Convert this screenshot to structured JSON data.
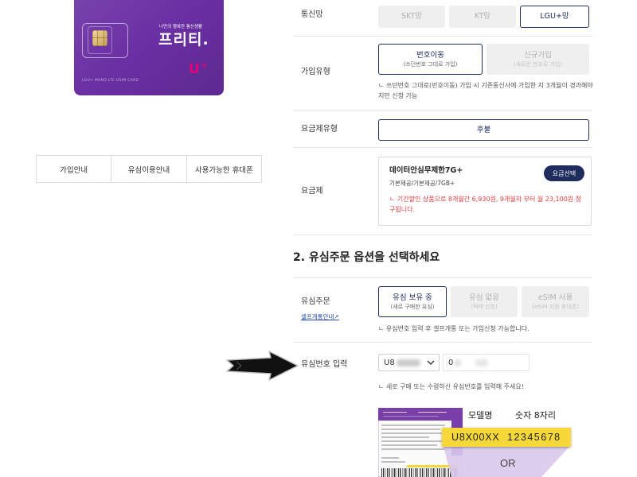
{
  "sim_card": {
    "tagline": "나만의 행복한 통신생활",
    "brand": "프리티.",
    "carrier_logo_letter": "U",
    "carrier_logo_plus": "+",
    "caption": "LGU+ MVNO LTE USIM CARD"
  },
  "info_tabs": [
    "가입안내",
    "유심이용안내",
    "사용가능한 휴대폰"
  ],
  "network": {
    "label": "통신망",
    "options": [
      {
        "label": "SKT망",
        "selected": false
      },
      {
        "label": "KT망",
        "selected": false
      },
      {
        "label": "LGU+망",
        "selected": true
      }
    ]
  },
  "join_type": {
    "label": "가입유형",
    "options": [
      {
        "title": "번호이동",
        "sub": "(쓰던번호 그대로 가입)",
        "selected": true
      },
      {
        "title": "신규가입",
        "sub": "(새로운 번호로 가입)",
        "selected": false
      }
    ],
    "note": "ㄴ 쓰던번호 그대로(번호이동) 가입 시 기존통신사에 가입한 지 3개월이 경과해야지만 신청 가능"
  },
  "plan_type": {
    "label": "요금제유형",
    "options": [
      {
        "label": "후불",
        "selected": true
      }
    ]
  },
  "plan": {
    "label": "요금제",
    "name": "데이터안심무제한7G+",
    "details": "기본제공/기본제공/7GB+",
    "select_button": "요금선택",
    "note": "ㄴ 기간할인 상품으로 8개월간 6,930원, 9개월차 부터 월 23,100원 청구됩니다."
  },
  "usim_section": {
    "title": "2. 유심주문 옵션을 선택하세요"
  },
  "usim_order": {
    "label": "유심주문",
    "help_link": "셀프개통안내",
    "help_link_icon": "↗",
    "options": [
      {
        "title": "유심 보유 중",
        "sub": "(새로 구매한 유심)",
        "selected": true
      },
      {
        "title": "유심 없음",
        "sub": "(택배 신청)",
        "selected": false
      },
      {
        "title": "eSIM 사용",
        "sub": "(eSIM 지원 휴대폰)",
        "selected": false
      }
    ],
    "note": "ㄴ 유심번호 입력 후 셀프개통 또는 가입신청 가능합니다."
  },
  "usim_number": {
    "label": "유심번호 입력",
    "model_value": "U8",
    "number_value": "0",
    "note": "ㄴ 새로 구매 또는 수령하신 유심번호를 입력해 주세요!"
  },
  "guide_image": {
    "model_label": "모델명",
    "digits_label": "숫자 8자리",
    "model_example": "U8X00XX",
    "digits_example": "12345678",
    "or_label": "OR"
  },
  "icons": {
    "sim_chip": "sim-chip-icon",
    "select_chevron": "chevron-down-icon",
    "help_link": "external-link-icon",
    "annotation_arrow": "arrow-right-icon"
  },
  "colors": {
    "accent_navy": "#1e2c5e",
    "button_grey": "#efefef",
    "button_grey_text": "#b2b2b2",
    "divider": "#e6e6e6",
    "note_red": "#e3393e",
    "link_blue": "#2747a8",
    "sim_purple": "#6a2fa3",
    "lgu_pink": "#e6007e",
    "highlight_yellow": "#f6d83a",
    "guide_purple": "#7a3ea9",
    "guide_lavender": "#d9c9ec"
  }
}
